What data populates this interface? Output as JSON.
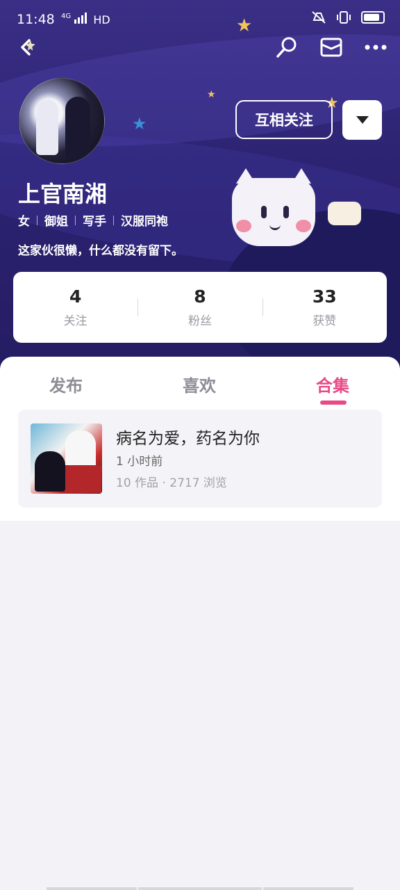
{
  "status_bar": {
    "time": "11:48",
    "network": "4G",
    "hd": "HD"
  },
  "profile": {
    "name": "上官南湘",
    "tags": [
      "女",
      "御姐",
      "写手",
      "汉服同袍"
    ],
    "bio": "这家伙很懒，什么都没有留下。",
    "follow_label": "互相关注"
  },
  "stats": [
    {
      "value": "4",
      "label": "关注"
    },
    {
      "value": "8",
      "label": "粉丝"
    },
    {
      "value": "33",
      "label": "获赞"
    }
  ],
  "tabs": [
    {
      "label": "发布",
      "active": false
    },
    {
      "label": "喜欢",
      "active": false
    },
    {
      "label": "合集",
      "active": true
    }
  ],
  "collections": [
    {
      "title": "病名为爱，药名为你",
      "time": "1 小时前",
      "meta": "10 作品 · 2717 浏览"
    }
  ],
  "colors": {
    "accent": "#e84a86",
    "hero": "#2c2372"
  },
  "icons": [
    "back-icon",
    "search-icon",
    "mail-icon",
    "more-icon",
    "chevron-down-icon"
  ]
}
